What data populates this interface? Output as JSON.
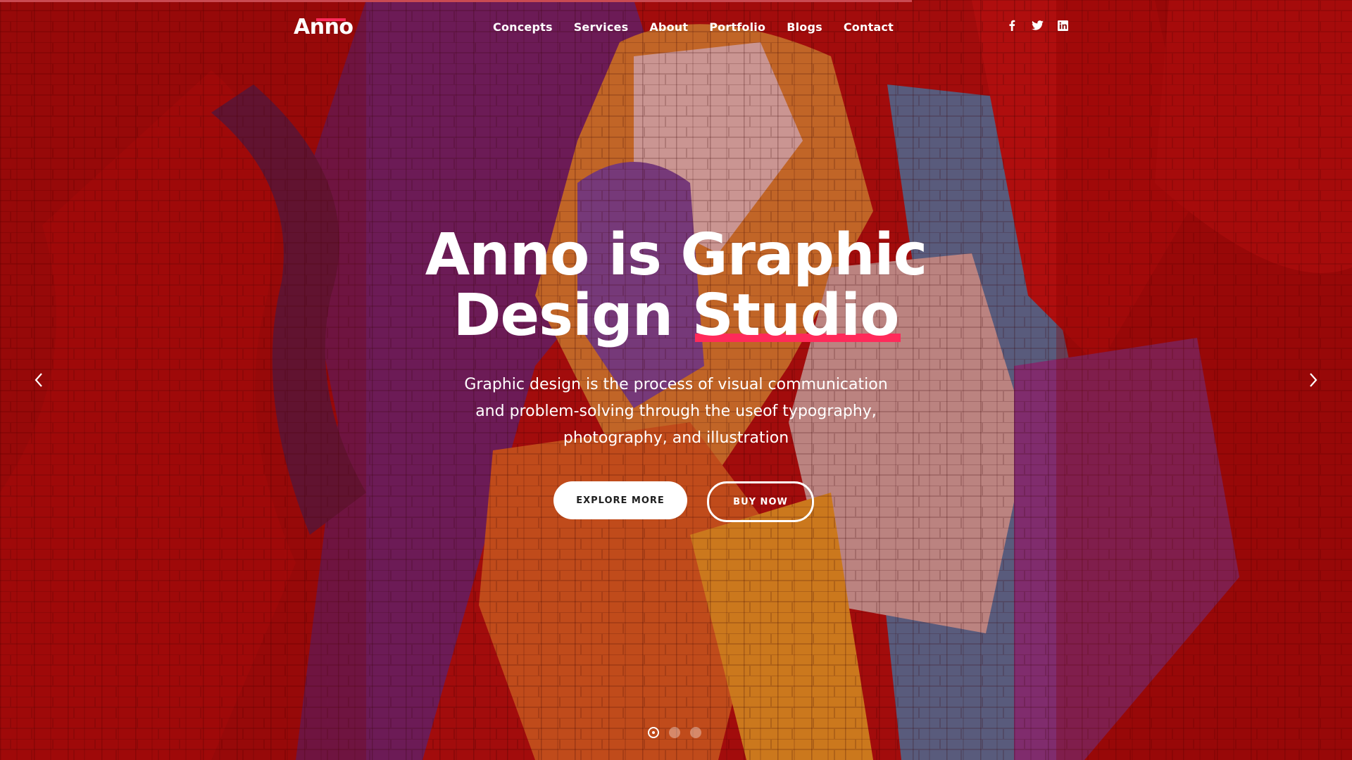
{
  "brand": {
    "logo_text": "Anno",
    "accent_color": "#ff2a5a"
  },
  "nav": {
    "items": [
      {
        "label": "Concepts"
      },
      {
        "label": "Services"
      },
      {
        "label": "About"
      },
      {
        "label": "Portfolio"
      },
      {
        "label": "Blogs"
      },
      {
        "label": "Contact"
      }
    ]
  },
  "social": [
    {
      "icon": "facebook-icon"
    },
    {
      "icon": "twitter-icon"
    },
    {
      "icon": "linkedin-icon"
    }
  ],
  "hero": {
    "headline_line1": "Anno is Graphic",
    "headline_line2_prefix": "Design",
    "headline_accent_word": "Studio",
    "subtitle": "Graphic design is the process of visual communication and problem-solving through the useof typography, photography, and illustration",
    "primary_button": "EXPLORE MORE",
    "secondary_button": "BUY NOW"
  },
  "slider": {
    "prev_icon": "chevron-left-icon",
    "next_icon": "chevron-right-icon",
    "total_slides": 3,
    "active_slide": 1
  },
  "colors": {
    "overlay_red": "#8a1010",
    "white": "#ffffff"
  }
}
